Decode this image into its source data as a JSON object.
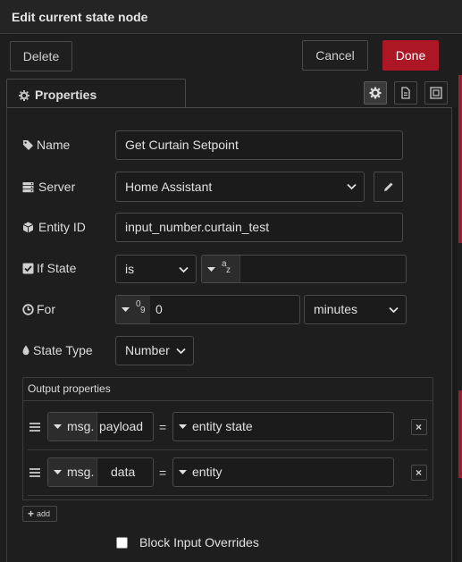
{
  "dialog": {
    "title": "Edit current state node"
  },
  "toolbar": {
    "delete_label": "Delete",
    "cancel_label": "Cancel",
    "done_label": "Done"
  },
  "tabs": {
    "properties_label": "Properties"
  },
  "form": {
    "name": {
      "label": "Name",
      "value": "Get Curtain Setpoint"
    },
    "server": {
      "label": "Server",
      "value": "Home Assistant"
    },
    "entity_id": {
      "label": "Entity ID",
      "value": "input_number.curtain_test"
    },
    "if_state": {
      "label": "If State",
      "operator": "is",
      "type_glyph": "a z",
      "value": ""
    },
    "for": {
      "label": "For",
      "type_glyph": "0 9",
      "value": "0",
      "unit": "minutes"
    },
    "state_type": {
      "label": "State Type",
      "value": "Number"
    }
  },
  "output": {
    "header": "Output properties",
    "rows": [
      {
        "prefix": "msg.",
        "property": "payload",
        "equals": "=",
        "value": "entity state"
      },
      {
        "prefix": "msg.",
        "property": "data",
        "equals": "=",
        "value": "entity"
      }
    ],
    "add_label": "add",
    "remove_glyph": "×"
  },
  "block_input_overrides": {
    "label": "Block Input Overrides",
    "checked": false
  },
  "colors": {
    "accent_done": "#ad1625",
    "background": "#1e1e1e"
  }
}
